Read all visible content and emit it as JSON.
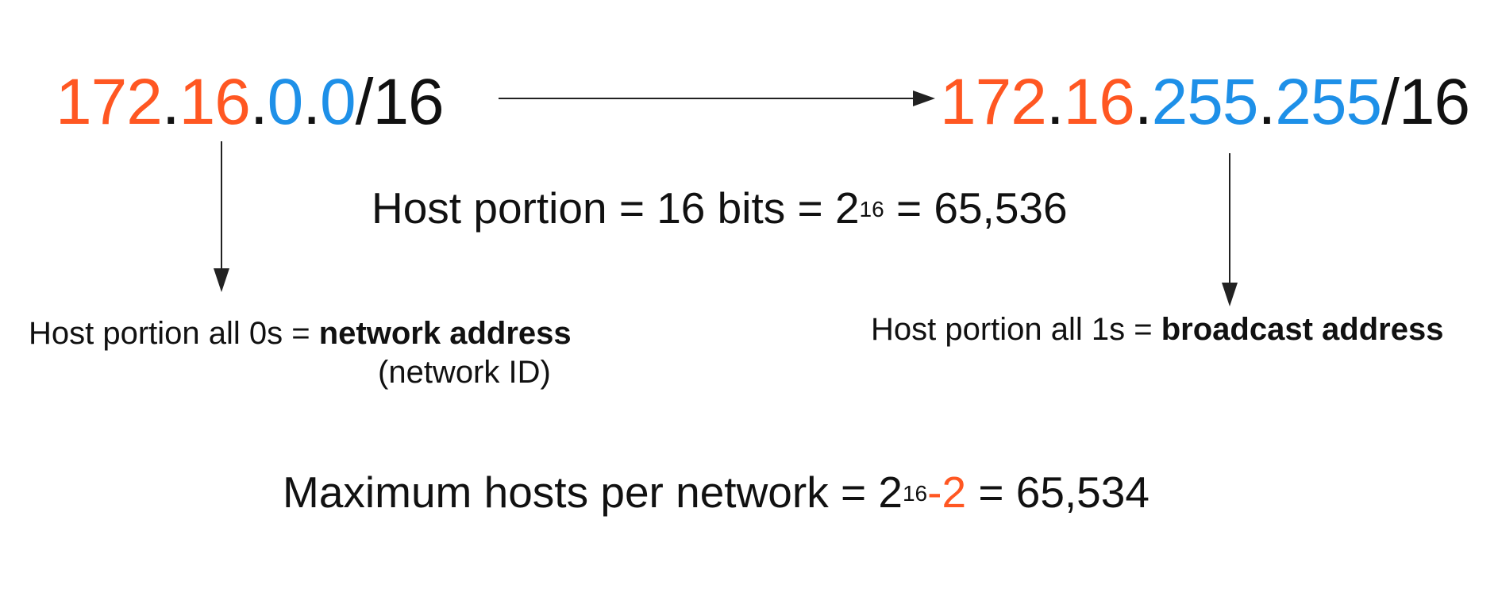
{
  "left_address": {
    "octet1": "172",
    "dot1": ".",
    "octet2": "16",
    "dot2": ".",
    "octet3": "0",
    "dot3": ".",
    "octet4": "0",
    "prefix": "/16"
  },
  "right_address": {
    "octet1": "172",
    "dot1": ".",
    "octet2": "16",
    "dot2": ".",
    "octet3": "255",
    "dot3": ".",
    "octet4": "255",
    "prefix": "/16"
  },
  "host_portion": {
    "text_before": "Host portion = 16 bits = 2",
    "exponent": "16",
    "text_after": " = 65,536"
  },
  "network_note": {
    "prefix": "Host portion all 0s = ",
    "bold": "network address",
    "second_line": "(network ID)"
  },
  "broadcast_note": {
    "prefix": "Host portion all 1s = ",
    "bold": "broadcast address"
  },
  "max_hosts": {
    "text_before": "Maximum hosts per network = 2",
    "exponent": "16",
    "minus_two": "-2",
    "text_after": " = 65,534"
  },
  "colors": {
    "network_portion": "#FF5722",
    "host_portion": "#1E90E8",
    "text": "#111111",
    "arrow": "#222222"
  }
}
